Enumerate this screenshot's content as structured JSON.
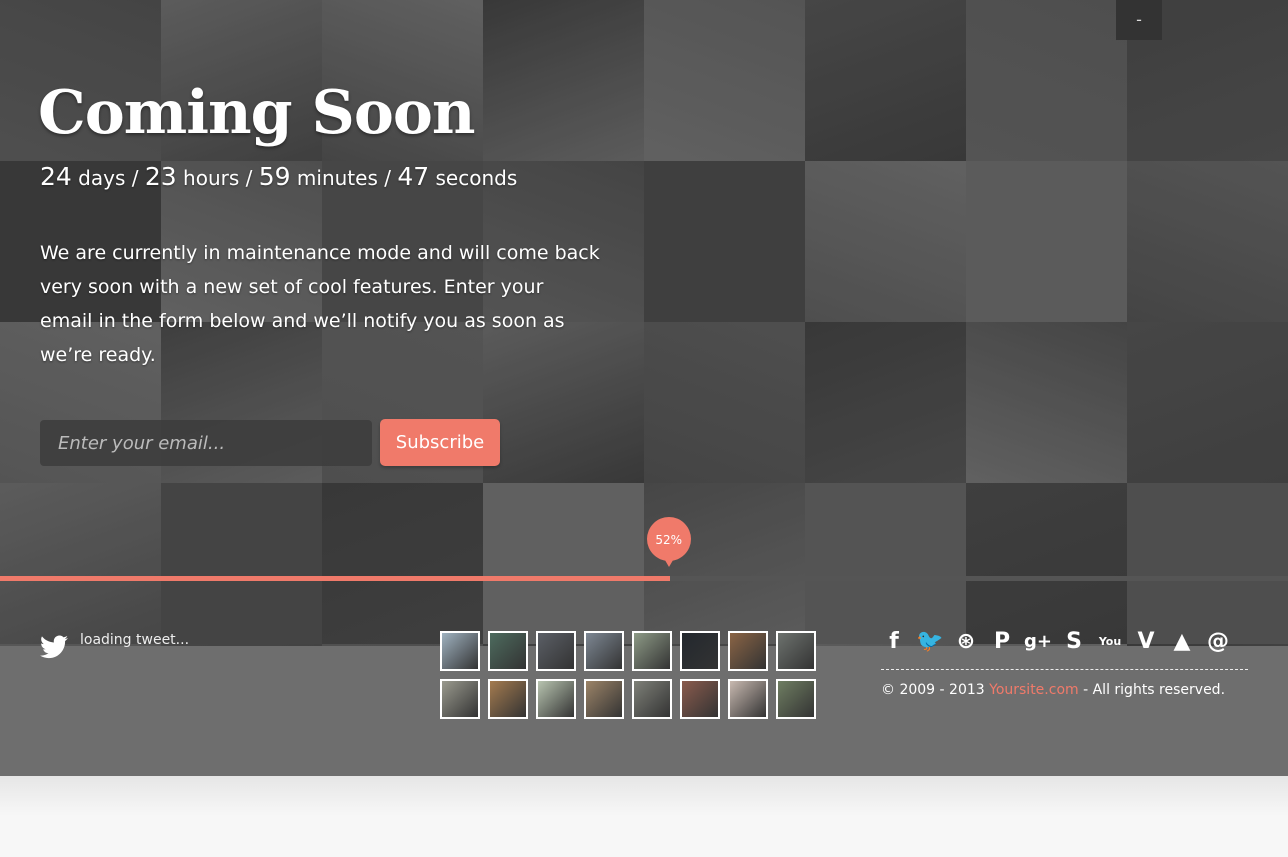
{
  "hero": {
    "title": "Coming Soon",
    "countdown": {
      "days": "24",
      "days_label": "days",
      "hours": "23",
      "hours_label": "hours",
      "minutes": "59",
      "minutes_label": "minutes",
      "seconds": "47",
      "seconds_label": "seconds",
      "separator": "/"
    },
    "message": "We are currently in maintenance mode and will come back very soon with a new set of cool features. Enter your email in the form below and we’ll notify you as soon as we’re ready."
  },
  "subscribe": {
    "email_placeholder": "Enter your email...",
    "button_label": "Subscribe"
  },
  "progress": {
    "percent": 52,
    "label": "52%"
  },
  "top_toggle": {
    "label": "-"
  },
  "twitter": {
    "icon": "twitter-bird-icon",
    "status": "loading tweet..."
  },
  "flickr": {
    "thumb_colors": [
      "#9fb2c0",
      "#4d6b5e",
      "#5b5f66",
      "#7d8793",
      "#8d9a86",
      "#23282e",
      "#8a6445",
      "#6d726e",
      "#9a9a8e",
      "#a47b4f",
      "#b8c4b0",
      "#9c8468",
      "#7e8078",
      "#8a5b4d",
      "#c8b9b0",
      "#6f7e62"
    ]
  },
  "social": {
    "icons": [
      "facebook-icon",
      "twitter-icon",
      "dribbble-icon",
      "pinterest-icon",
      "google-plus-icon",
      "skype-icon",
      "youtube-icon",
      "vimeo-icon",
      "forrst-icon",
      "email-icon"
    ],
    "glyphs": [
      "f",
      "🐦",
      "⊛",
      "P",
      "g+",
      "S",
      "You",
      "V",
      "▲",
      "@"
    ]
  },
  "footer": {
    "copyright_prefix": "© 2009 - 2013 ",
    "site_link": "Yoursite.com",
    "copyright_suffix": " - All rights reserved."
  },
  "colors": {
    "accent": "#f07a6a",
    "footer_bg": "#6e6e6e"
  }
}
